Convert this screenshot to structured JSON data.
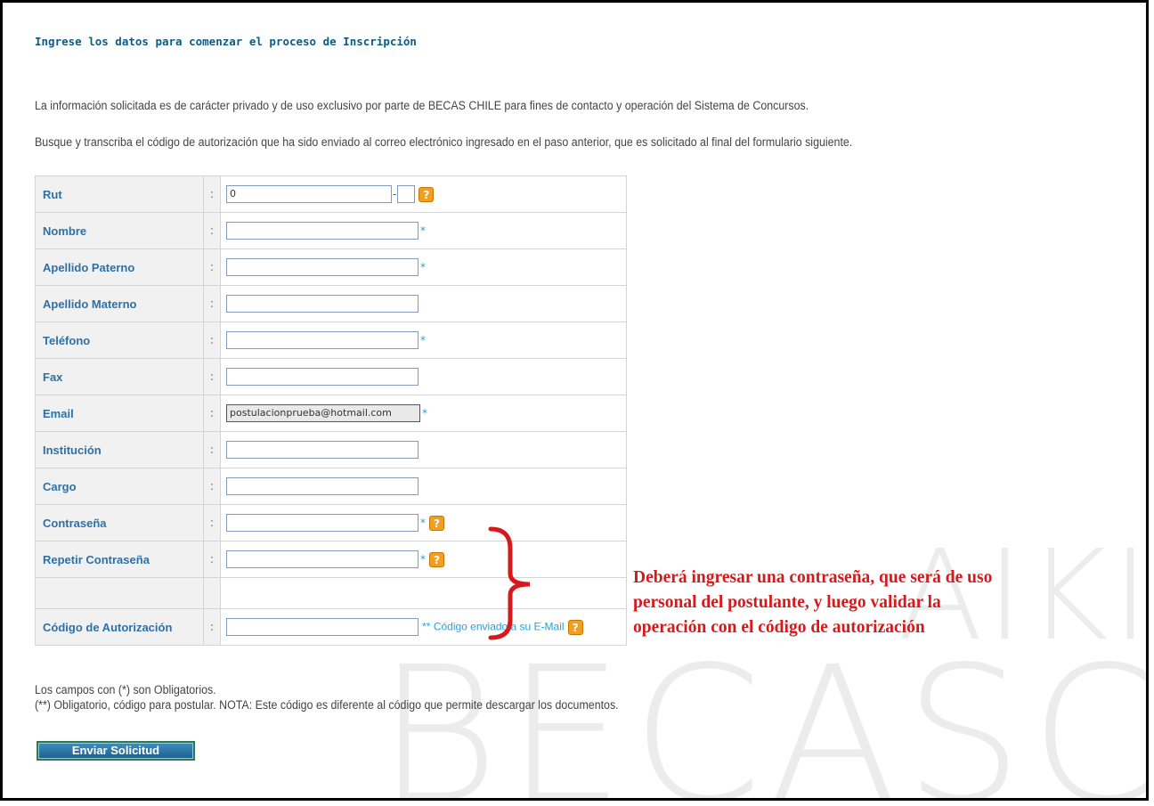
{
  "page": {
    "title": "Ingrese los datos para comenzar el proceso de Inscripción",
    "intro_privacy": "La información solicitada es de carácter privado y de uso exclusivo por parte de BECAS CHILE para fines de contacto y operación del Sistema de Concursos.",
    "intro_code": "Busque y transcriba el código de autorización que ha sido enviado al correo electrónico ingresado en el paso anterior, que es solicitado al final del formulario siguiente.",
    "watermark_line1": "AIKINEN",
    "watermark_line2": "BECASCH"
  },
  "form": {
    "separator": ":",
    "required_mark": "*",
    "help_glyph": "?",
    "rut": {
      "label": "Rut",
      "value": "0",
      "dash": "-",
      "dv_value": ""
    },
    "nombre": {
      "label": "Nombre",
      "value": ""
    },
    "apellido_paterno": {
      "label": "Apellido Paterno",
      "value": ""
    },
    "apellido_materno": {
      "label": "Apellido Materno",
      "value": ""
    },
    "telefono": {
      "label": "Teléfono",
      "value": ""
    },
    "fax": {
      "label": "Fax",
      "value": ""
    },
    "email": {
      "label": "Email",
      "value": "postulacionprueba@hotmail.com"
    },
    "institucion": {
      "label": "Institución",
      "value": ""
    },
    "cargo": {
      "label": "Cargo",
      "value": ""
    },
    "contrasena": {
      "label": "Contraseña",
      "value": ""
    },
    "repetir_contrasena": {
      "label": "Repetir Contraseña",
      "value": ""
    },
    "codigo": {
      "label": "Código de Autorización",
      "value": "",
      "note": "** Código enviado a su E-Mail"
    }
  },
  "annotation": {
    "line1": "Deberá ingresar una contraseña, que será de uso",
    "line2": "personal del postulante, y luego validar la",
    "line3": "operación con el código de autorización",
    "color": "#d7191b"
  },
  "footer": {
    "note_required": "Los campos con (*) son Obligatorios.",
    "note_code": "(**) Obligatorio, código para postular. NOTA: Este código es diferente al código que permite descargar los documentos.",
    "submit_label": "Enviar Solicitud"
  },
  "colors": {
    "label_blue": "#2d70a8",
    "title_blue": "#0b5c88",
    "required_blue": "#2aa0d8",
    "help_orange": "#f0a020"
  }
}
